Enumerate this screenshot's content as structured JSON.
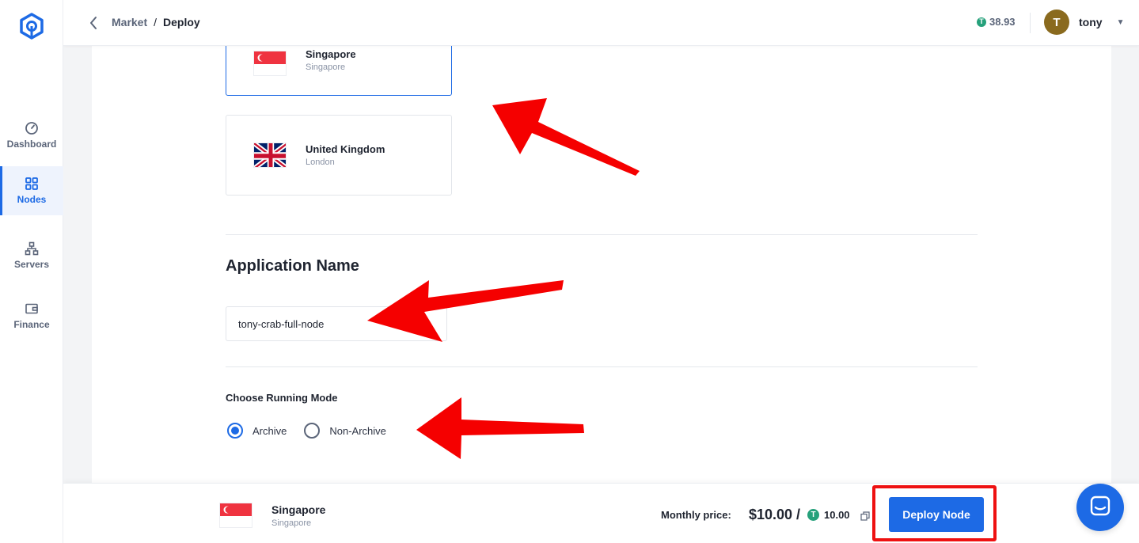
{
  "sidebar": {
    "items": [
      {
        "label": "Dashboard",
        "icon": "gauge-icon"
      },
      {
        "label": "Nodes",
        "icon": "grid-icon"
      },
      {
        "label": "Servers",
        "icon": "server-tree-icon"
      },
      {
        "label": "Finance",
        "icon": "wallet-icon"
      }
    ],
    "active": "Nodes"
  },
  "header": {
    "breadcrumb_parent": "Market",
    "breadcrumb_separator": "/",
    "breadcrumb_current": "Deploy",
    "balance_symbol": "T",
    "balance": "38.93",
    "user_initial": "T",
    "username": "tony"
  },
  "regions": [
    {
      "name": "Singapore",
      "city": "Singapore",
      "selected": true
    },
    {
      "name": "United Kingdom",
      "city": "London",
      "selected": false
    }
  ],
  "app_name": {
    "title": "Application Name",
    "value": "tony-crab-full-node"
  },
  "running_mode": {
    "label": "Choose Running Mode",
    "options": [
      "Archive",
      "Non-Archive"
    ],
    "selected": "Archive"
  },
  "footer": {
    "region_name": "Singapore",
    "region_city": "Singapore",
    "price_label": "Monthly price:",
    "price_usd": "$10.00 /",
    "price_usdt_symbol": "T",
    "price_usdt": "10.00",
    "deploy_label": "Deploy Node"
  },
  "colors": {
    "accent": "#1d6ae5",
    "annotation": "#ee1111",
    "usdt": "#26a17b"
  }
}
